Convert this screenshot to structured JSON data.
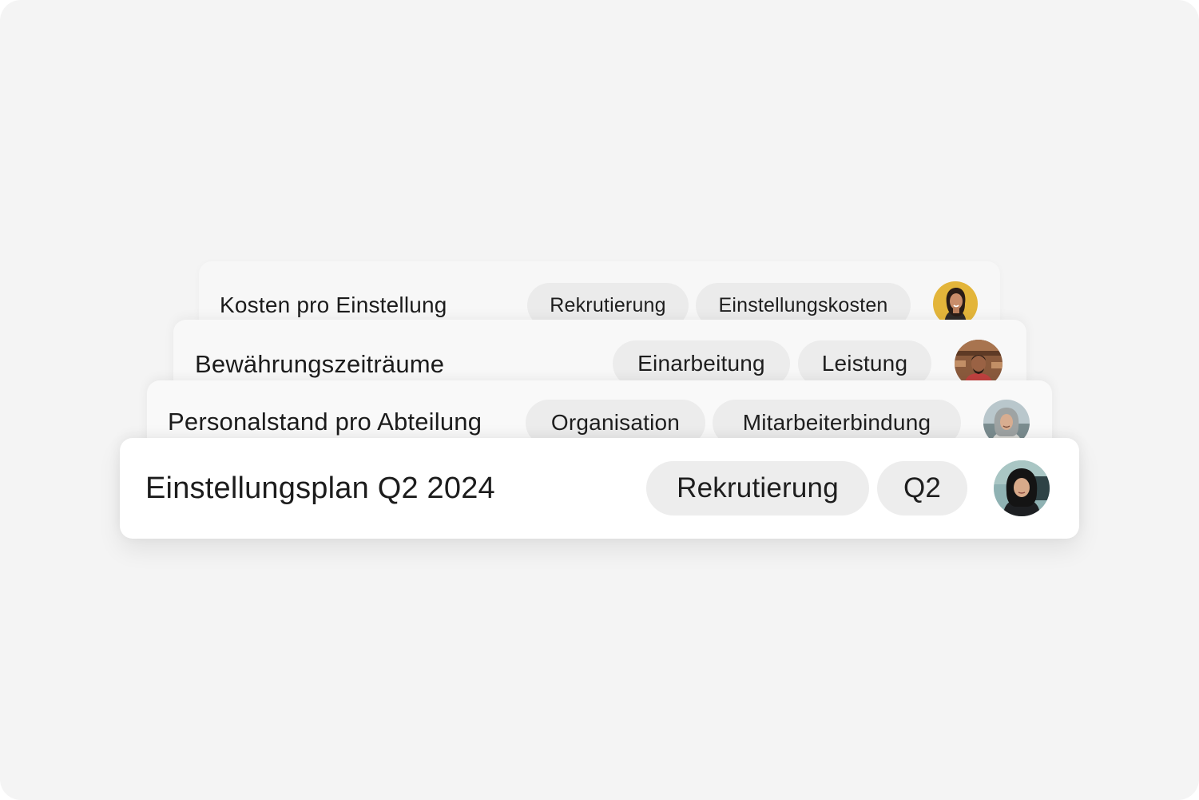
{
  "cards": [
    {
      "title": "Kosten pro Einstellung",
      "tags": [
        "Rekrutierung",
        "Einstellungskosten"
      ],
      "avatar": "woman-yellow-background-avatar"
    },
    {
      "title": "Bewährungszeiträume",
      "tags": [
        "Einarbeitung",
        "Leistung"
      ],
      "avatar": "man-workshop-avatar"
    },
    {
      "title": "Personalstand pro Abteilung",
      "tags": [
        "Organisation",
        "Mitarbeiterbindung"
      ],
      "avatar": "gray-haired-woman-avatar"
    },
    {
      "title": "Einstellungsplan Q2 2024",
      "tags": [
        "Rekrutierung",
        "Q2"
      ],
      "avatar": "woman-dark-hair-avatar"
    }
  ],
  "colors": {
    "background": "#f4f4f4",
    "card": "#ffffff",
    "tag": "#ececec",
    "text": "#1c1c1c"
  }
}
